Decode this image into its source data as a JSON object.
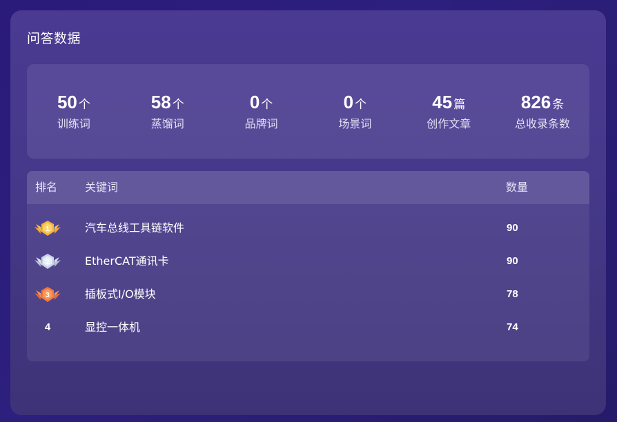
{
  "panel": {
    "title": "问答数据"
  },
  "stats": [
    {
      "value": "50",
      "unit": "个",
      "label": "训练词"
    },
    {
      "value": "58",
      "unit": "个",
      "label": "蒸馏词"
    },
    {
      "value": "0",
      "unit": "个",
      "label": "品牌词"
    },
    {
      "value": "0",
      "unit": "个",
      "label": "场景词"
    },
    {
      "value": "45",
      "unit": "篇",
      "label": "创作文章"
    },
    {
      "value": "826",
      "unit": "条",
      "label": "总收录条数"
    }
  ],
  "table": {
    "headers": {
      "rank": "排名",
      "keyword": "关键词",
      "count": "数量"
    },
    "rows": [
      {
        "rank": "1",
        "keyword": "汽车总线工具链软件",
        "count": "90",
        "medal": "gold-medal-icon"
      },
      {
        "rank": "2",
        "keyword": "EtherCAT通讯卡",
        "count": "90",
        "medal": "silver-medal-icon"
      },
      {
        "rank": "3",
        "keyword": "插板式I/O模块",
        "count": "78",
        "medal": "bronze-medal-icon"
      },
      {
        "rank": "4",
        "keyword": "显控一体机",
        "count": "74",
        "medal": ""
      }
    ]
  },
  "colors": {
    "gold": "#f6b43c",
    "silver": "#c9d3e6",
    "bronze": "#f07a3c"
  }
}
